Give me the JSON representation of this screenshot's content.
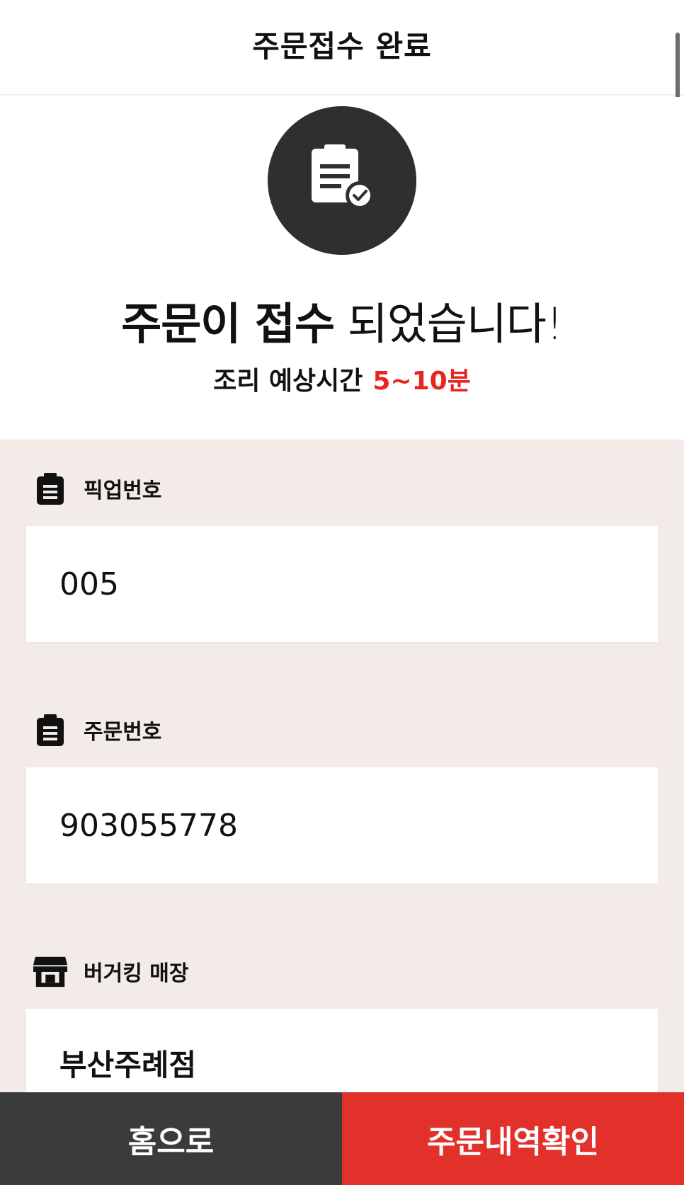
{
  "header": {
    "title": "주문접수 완료"
  },
  "hero": {
    "icon": "clipboard-check-icon",
    "message_bold": "주문이 접수",
    "message_light": " 되었습니다!",
    "eta_label": "조리 예상시간",
    "eta_value": "5~10분"
  },
  "sections": {
    "pickup": {
      "icon": "clipboard-icon",
      "label": "픽업번호",
      "value": "005"
    },
    "order": {
      "icon": "clipboard-icon",
      "label": "주문번호",
      "value": "903055778"
    },
    "store": {
      "icon": "store-icon",
      "label": "버거킹 매장",
      "value": "부산주례점"
    }
  },
  "buttons": {
    "home": "홈으로",
    "orders": "주문내역확인"
  },
  "colors": {
    "accent": "#e8251f",
    "dark": "#2f2f2f",
    "info_bg": "#f2ebe7"
  }
}
